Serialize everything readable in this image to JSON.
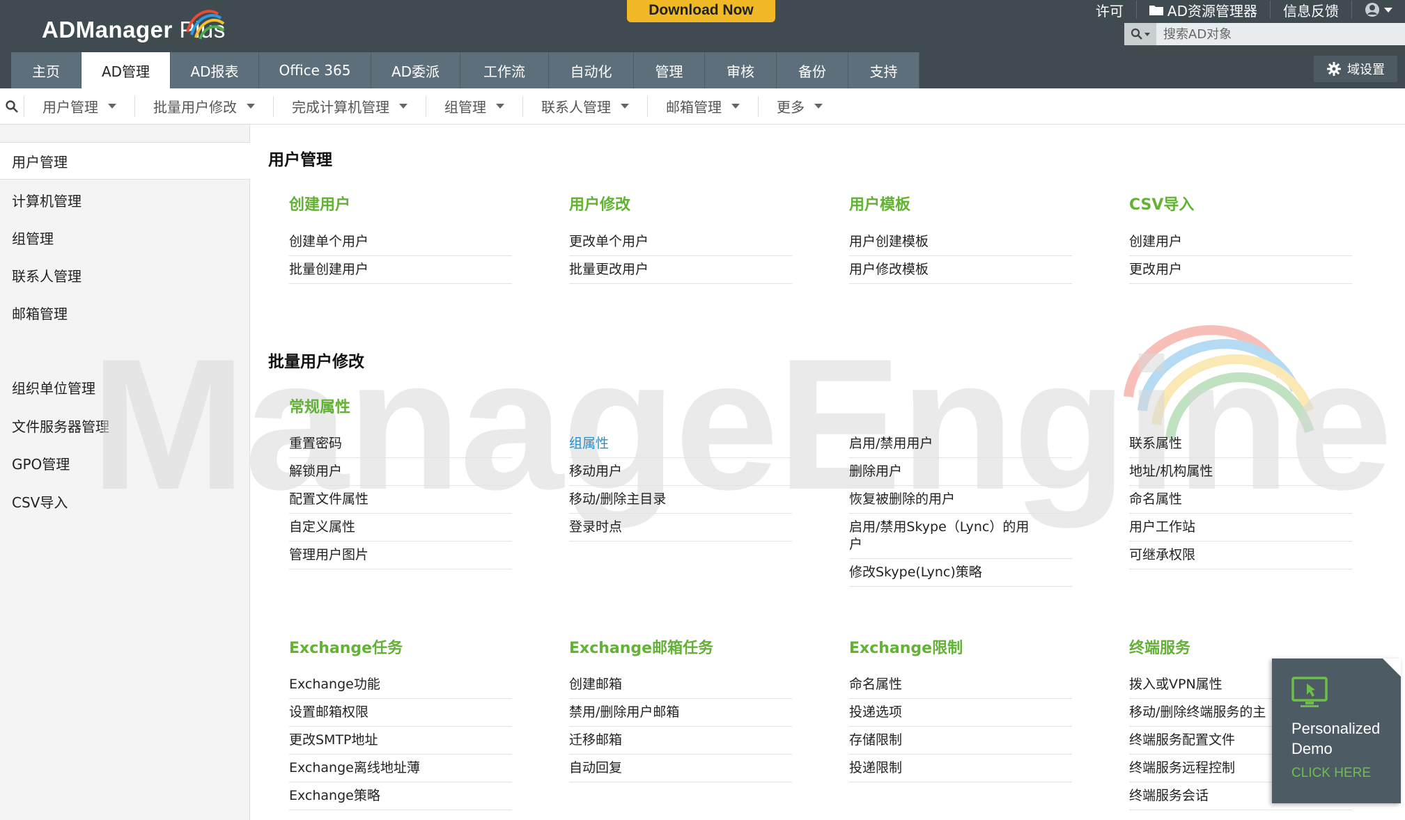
{
  "header": {
    "logo_text": "ADManager",
    "logo_plus": " Plus",
    "download_label": "Download Now",
    "links": [
      {
        "label": "许可",
        "icon": ""
      },
      {
        "label": "AD资源管理器",
        "icon": "folder-icon"
      },
      {
        "label": "信息反馈",
        "icon": ""
      },
      {
        "label": "",
        "icon": "user-icon"
      }
    ],
    "search_placeholder": "搜索AD对象",
    "domain_settings_label": "域设置"
  },
  "main_tabs": [
    {
      "label": "主页",
      "active": false
    },
    {
      "label": "AD管理",
      "active": true
    },
    {
      "label": "AD报表",
      "active": false
    },
    {
      "label": "Office 365",
      "active": false
    },
    {
      "label": "AD委派",
      "active": false
    },
    {
      "label": "工作流",
      "active": false
    },
    {
      "label": "自动化",
      "active": false
    },
    {
      "label": "管理",
      "active": false
    },
    {
      "label": "审核",
      "active": false
    },
    {
      "label": "备份",
      "active": false
    },
    {
      "label": "支持",
      "active": false
    }
  ],
  "subnav": [
    "用户管理",
    "批量用户修改",
    "完成计算机管理",
    "组管理",
    "联系人管理",
    "邮箱管理",
    "更多"
  ],
  "sidebar": [
    {
      "label": "用户管理",
      "active": true
    },
    {
      "label": "计算机管理",
      "active": false
    },
    {
      "label": "组管理",
      "active": false
    },
    {
      "label": "联系人管理",
      "active": false
    },
    {
      "label": "邮箱管理",
      "active": false
    },
    {
      "label": "组织单位管理",
      "active": false
    },
    {
      "label": "文件服务器管理",
      "active": false
    },
    {
      "label": "GPO管理",
      "active": false
    },
    {
      "label": "CSV导入",
      "active": false
    }
  ],
  "watermark": "ManageEngine",
  "sections": {
    "user_management": {
      "title": "用户管理",
      "groups": [
        {
          "title": "创建用户",
          "items": [
            "创建单个用户",
            "批量创建用户"
          ]
        },
        {
          "title": "用户修改",
          "items": [
            "更改单个用户",
            "批量更改用户"
          ]
        },
        {
          "title": "用户模板",
          "items": [
            "用户创建模板",
            "用户修改模板"
          ]
        },
        {
          "title": "CSV导入",
          "items": [
            "创建用户",
            "更改用户"
          ]
        }
      ]
    },
    "bulk_modify": {
      "title": "批量用户修改",
      "general_title": "常规属性",
      "columns": [
        [
          "重置密码",
          "解锁用户",
          "配置文件属性",
          "自定义属性",
          "管理用户图片"
        ],
        [
          "组属性",
          "移动用户",
          "移动/删除主目录",
          "登录时点"
        ],
        [
          "启用/禁用用户",
          "删除用户",
          "恢复被删除的用户",
          "启用/禁用Skype（Lync）的用户",
          "修改Skype(Lync)策略"
        ],
        [
          "联系属性",
          "地址/机构属性",
          "命名属性",
          "用户工作站",
          "可继承权限"
        ]
      ],
      "exchange_groups": [
        {
          "title": "Exchange任务",
          "items": [
            "Exchange功能",
            "设置邮箱权限",
            "更改SMTP地址",
            "Exchange离线地址薄",
            "Exchange策略"
          ]
        },
        {
          "title": "Exchange邮箱任务",
          "items": [
            "创建邮箱",
            "禁用/删除用户邮箱",
            "迁移邮箱",
            "自动回复"
          ]
        },
        {
          "title": "Exchange限制",
          "items": [
            "命名属性",
            "投递选项",
            "存储限制",
            "投递限制"
          ]
        },
        {
          "title": "终端服务",
          "items": [
            "拨入或VPN属性",
            "移动/删除终端服务的主",
            "终端服务配置文件",
            "终端服务远程控制",
            "终端服务会话"
          ]
        }
      ]
    }
  },
  "demo": {
    "title_line1": "Personalized",
    "title_line2": "Demo",
    "cta": "CLICK HERE"
  },
  "colors": {
    "topbar": "#3f4a51",
    "tab": "#5d6f7b",
    "accent_green": "#62b234",
    "link_blue": "#2a8fc8",
    "download": "#f0b925"
  }
}
